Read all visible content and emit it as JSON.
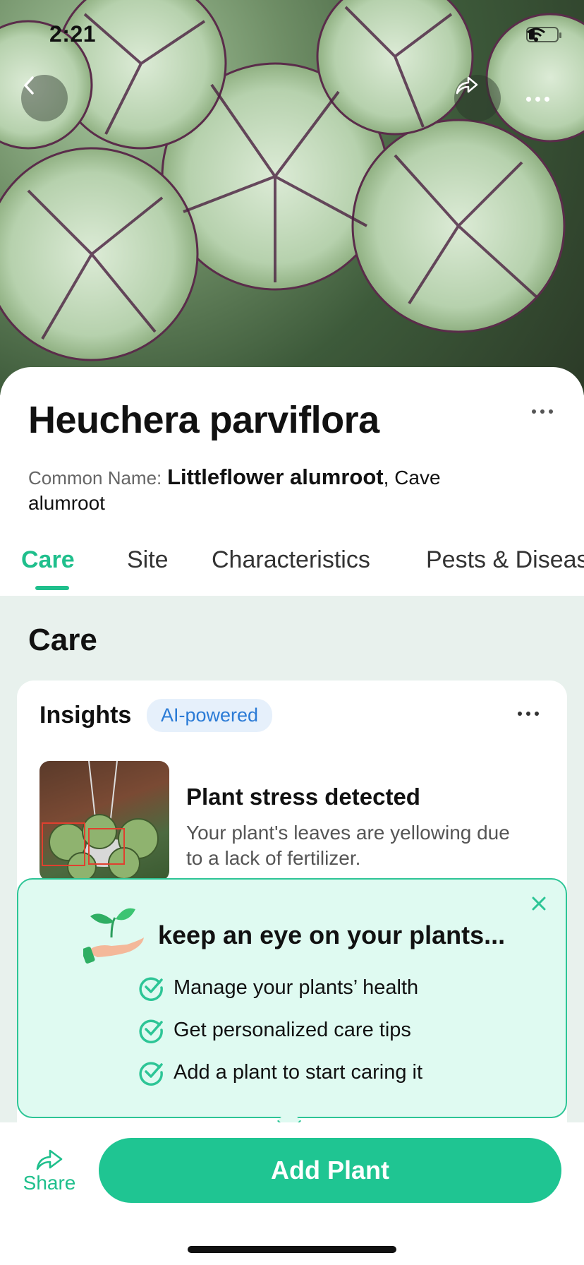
{
  "status_bar": {
    "time": "2:21"
  },
  "hero": {
    "back_icon": "chevron-left-icon",
    "share_icon": "share-icon",
    "more_icon": "more-horizontal-icon"
  },
  "plant": {
    "scientific_name": "Heuchera parviflora",
    "common_name_label": "Common Name:",
    "common_name_primary": "Littleflower alumroot",
    "common_name_rest": ", Cave alumroot"
  },
  "tabs": [
    {
      "label": "Care",
      "active": true
    },
    {
      "label": "Site",
      "active": false
    },
    {
      "label": "Characteristics",
      "active": false
    },
    {
      "label": "Pests & Diseas",
      "active": false
    }
  ],
  "care": {
    "heading": "Care",
    "insights": {
      "title": "Insights",
      "badge": "AI-powered",
      "item_title": "Plant stress detected",
      "item_desc": "Your plant's leaves are yellowing due to a lack of fertilizer."
    }
  },
  "popup": {
    "title": "keep an eye on your plants...",
    "items": [
      "Manage your plants’ health",
      "Get personalized care tips",
      "Add a plant to start caring it"
    ]
  },
  "bottom": {
    "share_label": "Share",
    "add_plant_label": "Add Plant"
  },
  "colors": {
    "accent": "#1fbf8c",
    "ai_badge_text": "#2b7bd6",
    "popup_bg": "#dffaf1"
  }
}
